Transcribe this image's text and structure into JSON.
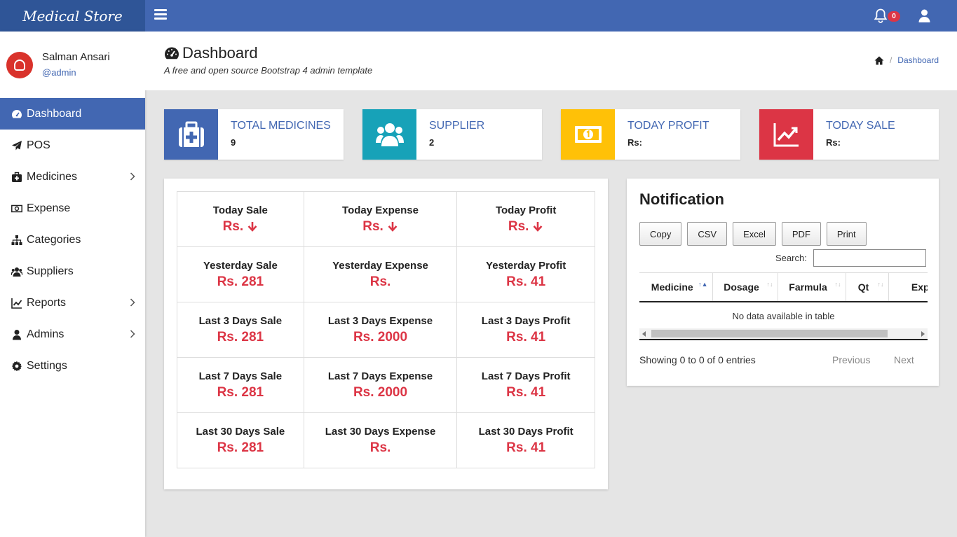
{
  "brand": "Medical Store",
  "topbar": {
    "notification_count": "0"
  },
  "profile": {
    "name": "Salman Ansari",
    "role": "@admin"
  },
  "sidebar": {
    "items": [
      {
        "label": "Dashboard",
        "icon": "dashboard-icon",
        "active": true
      },
      {
        "label": "POS",
        "icon": "paper-plane-icon"
      },
      {
        "label": "Medicines",
        "icon": "medkit-icon",
        "has_submenu": true
      },
      {
        "label": "Expense",
        "icon": "money-icon"
      },
      {
        "label": "Categories",
        "icon": "sitemap-icon"
      },
      {
        "label": "Suppliers",
        "icon": "users-icon"
      },
      {
        "label": "Reports",
        "icon": "line-chart-icon",
        "has_submenu": true
      },
      {
        "label": "Admins",
        "icon": "user-icon",
        "has_submenu": true
      },
      {
        "label": "Settings",
        "icon": "gear-icon"
      }
    ]
  },
  "header": {
    "title": "Dashboard",
    "subtitle": "A free and open source Bootstrap 4 admin template",
    "breadcrumb": "Dashboard"
  },
  "cards": [
    {
      "title": "TOTAL MEDICINES",
      "value": "9",
      "color": "#4267b2",
      "icon": "medkit-icon"
    },
    {
      "title": "SUPPLIER",
      "value": "2",
      "color": "#17a2b8",
      "icon": "users-icon"
    },
    {
      "title": "TODAY PROFIT",
      "value": "Rs:",
      "color": "#ffc107",
      "icon": "money-icon"
    },
    {
      "title": "TODAY SALE",
      "value": "Rs:",
      "color": "#dc3545",
      "icon": "line-chart-icon"
    }
  ],
  "stats": [
    [
      {
        "label": "Today Sale",
        "value": "Rs.",
        "arrow": true
      },
      {
        "label": "Today Expense",
        "value": "Rs.",
        "arrow": true
      },
      {
        "label": "Today Profit",
        "value": "Rs.",
        "arrow": true
      }
    ],
    [
      {
        "label": "Yesterday Sale",
        "value": "Rs. 281"
      },
      {
        "label": "Yesterday Expense",
        "value": "Rs."
      },
      {
        "label": "Yesterday Profit",
        "value": "Rs. 41"
      }
    ],
    [
      {
        "label": "Last 3 Days Sale",
        "value": "Rs. 281"
      },
      {
        "label": "Last 3 Days Expense",
        "value": "Rs. 2000"
      },
      {
        "label": "Last 3 Days Profit",
        "value": "Rs. 41"
      }
    ],
    [
      {
        "label": "Last 7 Days Sale",
        "value": "Rs. 281"
      },
      {
        "label": "Last 7 Days Expense",
        "value": "Rs. 2000"
      },
      {
        "label": "Last 7 Days Profit",
        "value": "Rs. 41"
      }
    ],
    [
      {
        "label": "Last 30 Days Sale",
        "value": "Rs. 281"
      },
      {
        "label": "Last 30 Days Expense",
        "value": "Rs."
      },
      {
        "label": "Last 30 Days Profit",
        "value": "Rs. 41"
      }
    ]
  ],
  "notification": {
    "title": "Notification",
    "buttons": [
      "Copy",
      "CSV",
      "Excel",
      "PDF",
      "Print"
    ],
    "search_label": "Search:",
    "search_value": "",
    "columns": [
      "Medicine",
      "Dosage",
      "Farmula",
      "Qt",
      "Exp.D"
    ],
    "empty_text": "No data available in table",
    "info": "Showing 0 to 0 of 0 entries",
    "prev": "Previous",
    "next": "Next"
  },
  "colors": {
    "primary": "#4267b2",
    "brand_bg": "#2f5597",
    "danger": "#dc3545"
  }
}
